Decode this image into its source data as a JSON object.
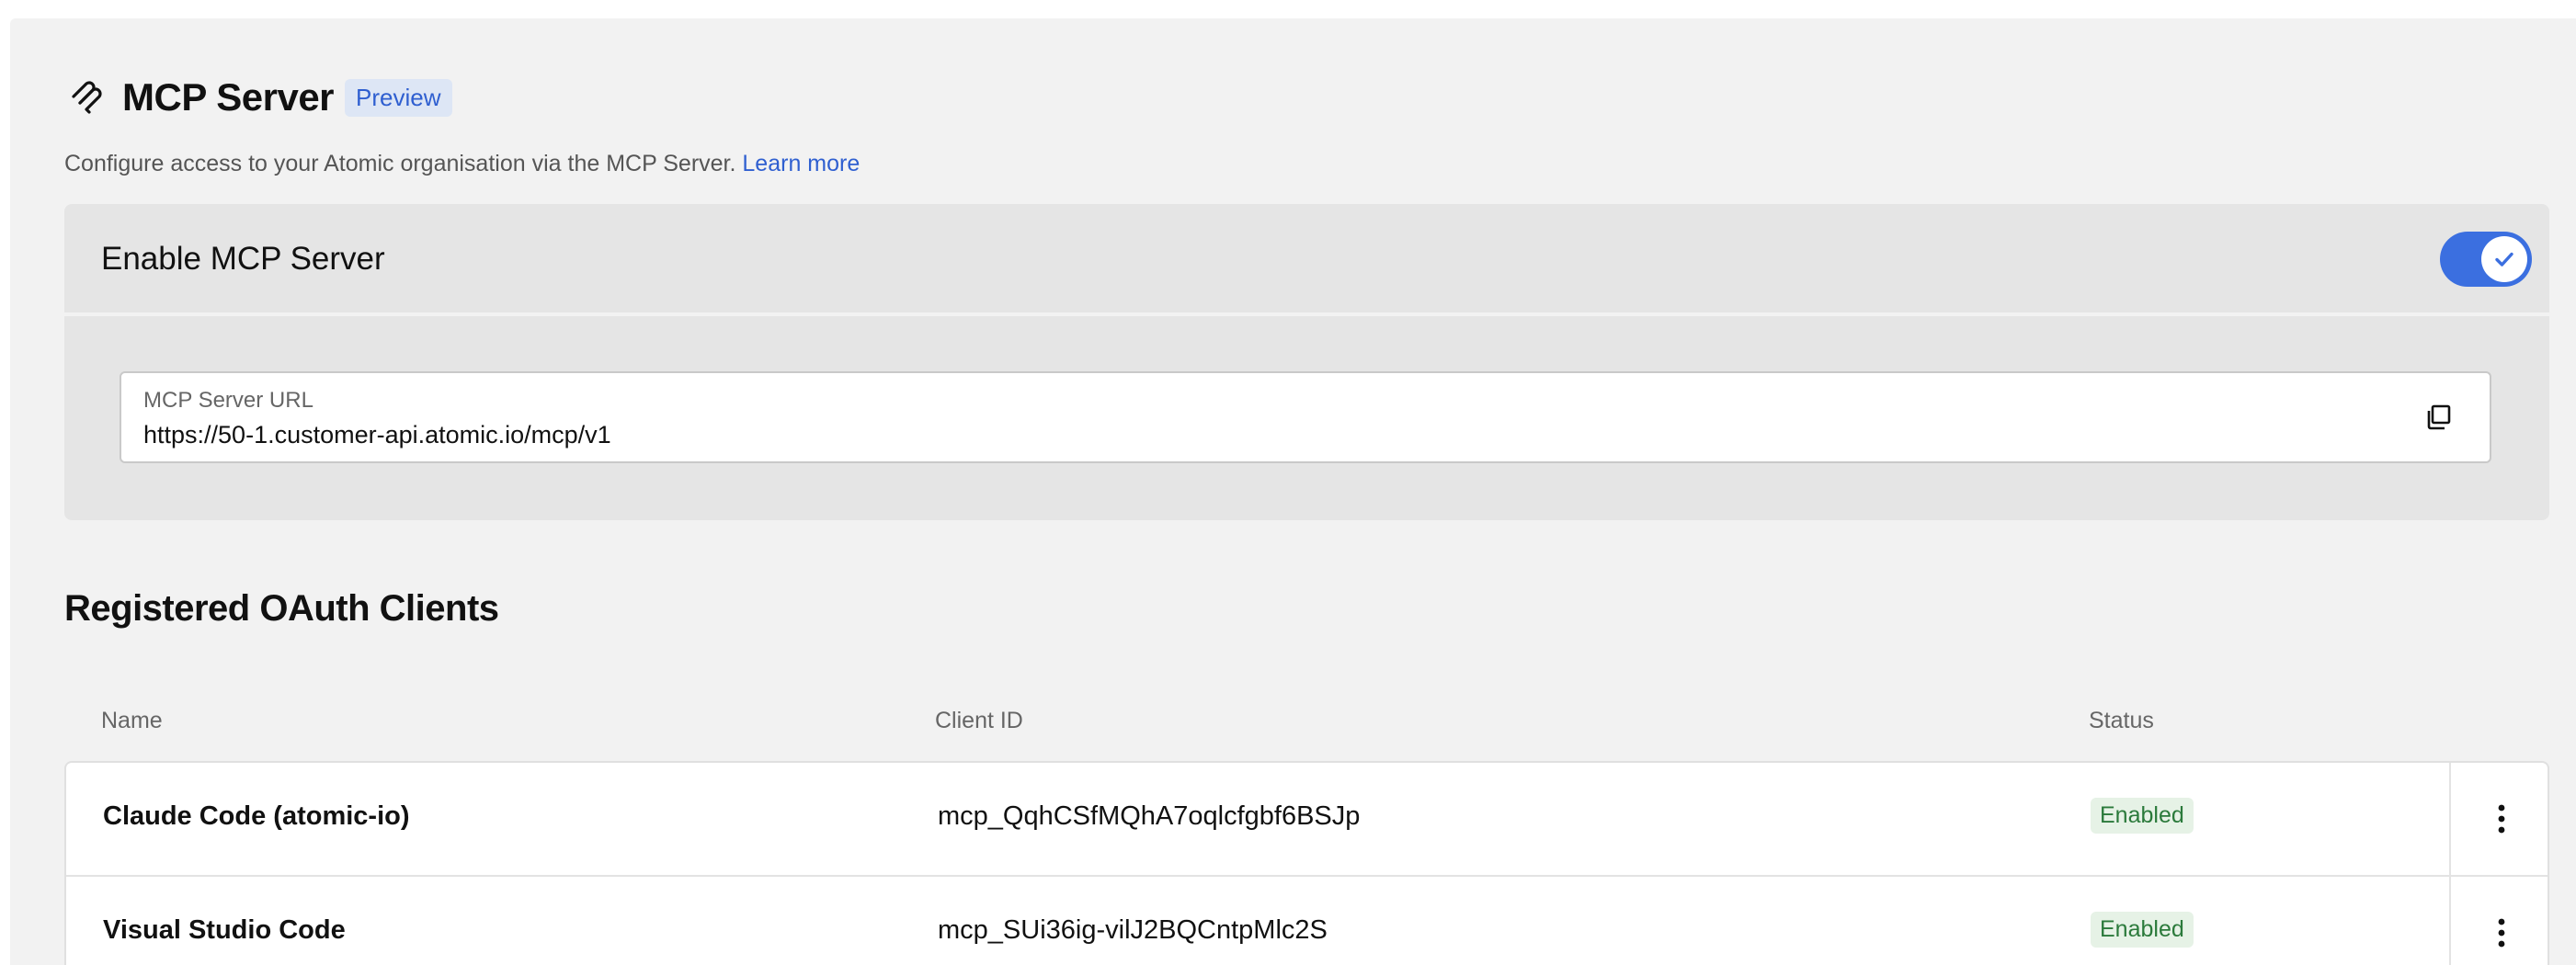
{
  "header": {
    "title": "MCP Server",
    "badge": "Preview",
    "icon": "mcp-logo-icon"
  },
  "subtitle": {
    "text": "Configure access to your Atomic organisation via the MCP Server.",
    "link": "Learn more"
  },
  "enable": {
    "label": "Enable MCP Server",
    "enabled": true
  },
  "url_field": {
    "label": "MCP Server URL",
    "value": "https://50-1.customer-api.atomic.io/mcp/v1",
    "copy_icon": "copy-icon"
  },
  "clients": {
    "title": "Registered OAuth Clients",
    "columns": {
      "name": "Name",
      "client_id": "Client ID",
      "status": "Status"
    },
    "rows": [
      {
        "name": "Claude Code (atomic-io)",
        "client_id": "mcp_QqhCSfMQhA7oqlcfgbf6BSJp",
        "status": "Enabled"
      },
      {
        "name": "Visual Studio Code",
        "client_id": "mcp_SUi36ig-vilJ2BQCntpMlc2S",
        "status": "Enabled"
      }
    ]
  },
  "colors": {
    "accent": "#3b6fe0",
    "link": "#2f5fd0",
    "status_text": "#2b7a3b",
    "status_bg": "#e6f2e6"
  }
}
